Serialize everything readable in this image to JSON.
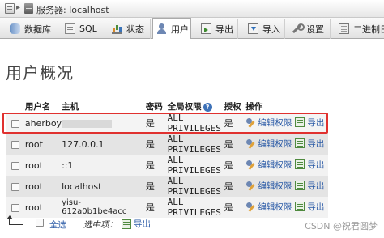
{
  "breadcrumb": {
    "server_label": "服务器: localhost"
  },
  "tabs": [
    {
      "label": "数据库",
      "icon": "database-icon"
    },
    {
      "label": "SQL",
      "icon": "sql-icon"
    },
    {
      "label": "状态",
      "icon": "status-icon"
    },
    {
      "label": "用户",
      "icon": "user-icon",
      "active": true
    },
    {
      "label": "导出",
      "icon": "export-icon"
    },
    {
      "label": "导入",
      "icon": "import-icon"
    },
    {
      "label": "设置",
      "icon": "wrench-icon"
    },
    {
      "label": "二进制日",
      "icon": "binlog-icon"
    }
  ],
  "page_title": "用户概况",
  "table": {
    "headers": {
      "user": "用户名",
      "host": "主机",
      "password": "密码",
      "privileges": "全局权限",
      "help": "?",
      "grant": "授权",
      "action": "操作"
    },
    "rows": [
      {
        "user": "aherboy",
        "host": "",
        "password": "是",
        "privileges": "ALL PRIVILEGES",
        "grant": "是",
        "edit": "编辑权限",
        "export": "导出"
      },
      {
        "user": "root",
        "host": "127.0.0.1",
        "password": "是",
        "privileges": "ALL PRIVILEGES",
        "grant": "是",
        "edit": "编辑权限",
        "export": "导出"
      },
      {
        "user": "root",
        "host": "::1",
        "password": "是",
        "privileges": "ALL PRIVILEGES",
        "grant": "是",
        "edit": "编辑权限",
        "export": "导出"
      },
      {
        "user": "root",
        "host": "localhost",
        "password": "是",
        "privileges": "ALL PRIVILEGES",
        "grant": "是",
        "edit": "编辑权限",
        "export": "导出"
      },
      {
        "user": "root",
        "host": "yisu-612a0b1be4acc",
        "password": "是",
        "privileges": "ALL PRIVILEGES",
        "grant": "是",
        "edit": "编辑权限",
        "export": "导出"
      }
    ]
  },
  "footer": {
    "select_all": "全选",
    "with_selected": "选中项：",
    "export": "导出"
  },
  "watermark": "CSDN @祝君圆梦",
  "colors": {
    "link": "#2a5aa6",
    "highlight": "#e0312f"
  }
}
